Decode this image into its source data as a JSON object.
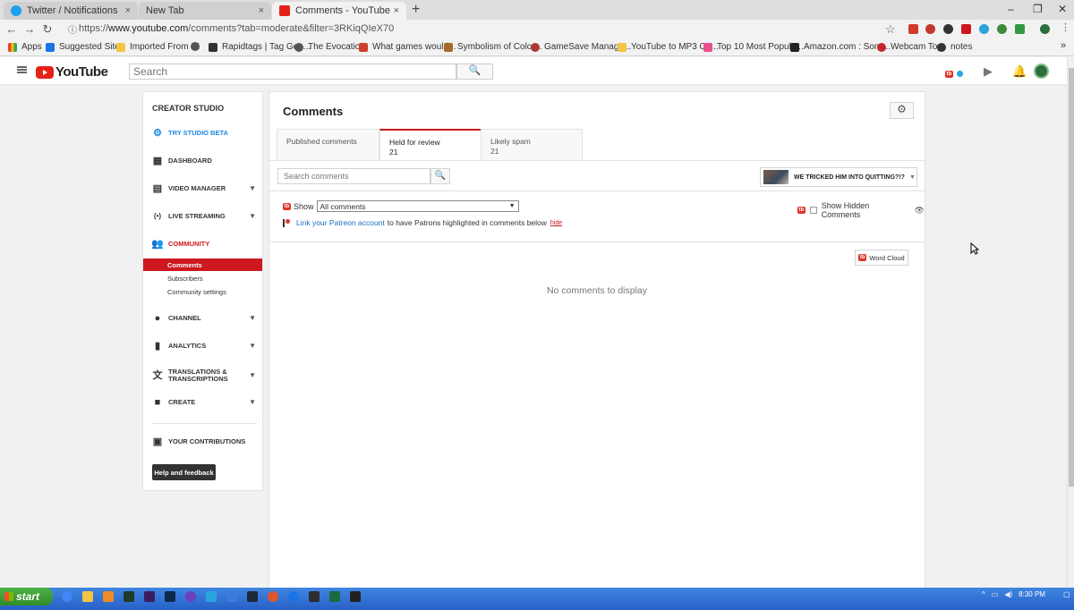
{
  "browser": {
    "tabs": [
      {
        "label": "Twitter / Notifications",
        "close": "×"
      },
      {
        "label": "New Tab",
        "close": "×"
      },
      {
        "label": "Comments - YouTube",
        "close": "×"
      }
    ],
    "new_tab": "+",
    "window_controls": {
      "minimize": "–",
      "maximize": "❐",
      "close": "✕"
    },
    "nav": {
      "back": "←",
      "forward": "→",
      "reload": "↻",
      "info": "ⓘ"
    },
    "url_scheme": "https://",
    "url_host": "www.youtube.com",
    "url_path": "/comments?tab=moderate&filter=3RKiqQIeX70",
    "bookmark_star": "☆",
    "bookmarks": [
      "Apps",
      "Suggested Sites",
      "Imported From IE",
      "",
      "Rapidtags | Tag Gen...",
      "The Evocation",
      "What games would...",
      "Symbolism of Color...",
      "GameSave Manage...",
      "YouTube to MP3 Co...",
      "Top 10 Most Popula...",
      "Amazon.com : Sony...",
      "Webcam Toy",
      "notes"
    ],
    "bookmarks_more": "»"
  },
  "youtube": {
    "logo_text": "YouTube",
    "search_placeholder": "Search",
    "search_btn": "🔍"
  },
  "sidebar": {
    "header": "CREATOR STUDIO",
    "items": [
      {
        "label": "TRY STUDIO BETA",
        "icon": "gear"
      },
      {
        "label": "DASHBOARD",
        "icon": "dashboard"
      },
      {
        "label": "VIDEO MANAGER",
        "icon": "video-manager"
      },
      {
        "label": "LIVE STREAMING",
        "icon": "live"
      },
      {
        "label": "COMMUNITY",
        "icon": "community"
      },
      {
        "label": "CHANNEL",
        "icon": "channel"
      },
      {
        "label": "ANALYTICS",
        "icon": "analytics"
      },
      {
        "label": "TRANSLATIONS & TRANSCRIPTIONS",
        "icon": "translate"
      },
      {
        "label": "CREATE",
        "icon": "create"
      },
      {
        "label": "YOUR CONTRIBUTIONS",
        "icon": "contributions"
      }
    ],
    "community_sub": [
      "Comments",
      "Subscribers",
      "Community settings"
    ],
    "help_button": "Help and feedback"
  },
  "main": {
    "title": "Comments",
    "tabs": [
      {
        "label": "Published comments",
        "count": ""
      },
      {
        "label": "Held for review",
        "count": "21"
      },
      {
        "label": "Likely spam",
        "count": "21"
      }
    ],
    "search_placeholder": "Search comments",
    "video_title": "WE TRICKED HIM INTO QUITTING?!? T...",
    "show_label": "Show",
    "show_value": "All comments",
    "show_hidden_label": "Show Hidden Comments",
    "patreon_link": "Link your Patreon account",
    "patreon_text": "to have Patrons highlighted in comments below",
    "patreon_hide": "hide",
    "word_cloud": "Word Cloud",
    "empty_message": "No comments to display"
  },
  "taskbar": {
    "start": "start",
    "time": "8:30 PM"
  },
  "colors": {
    "youtube_red": "#cc181e",
    "link_blue": "#1a6fbf",
    "studio_blue": "#1e88e5",
    "taskbar_blue": "#2860c8"
  }
}
